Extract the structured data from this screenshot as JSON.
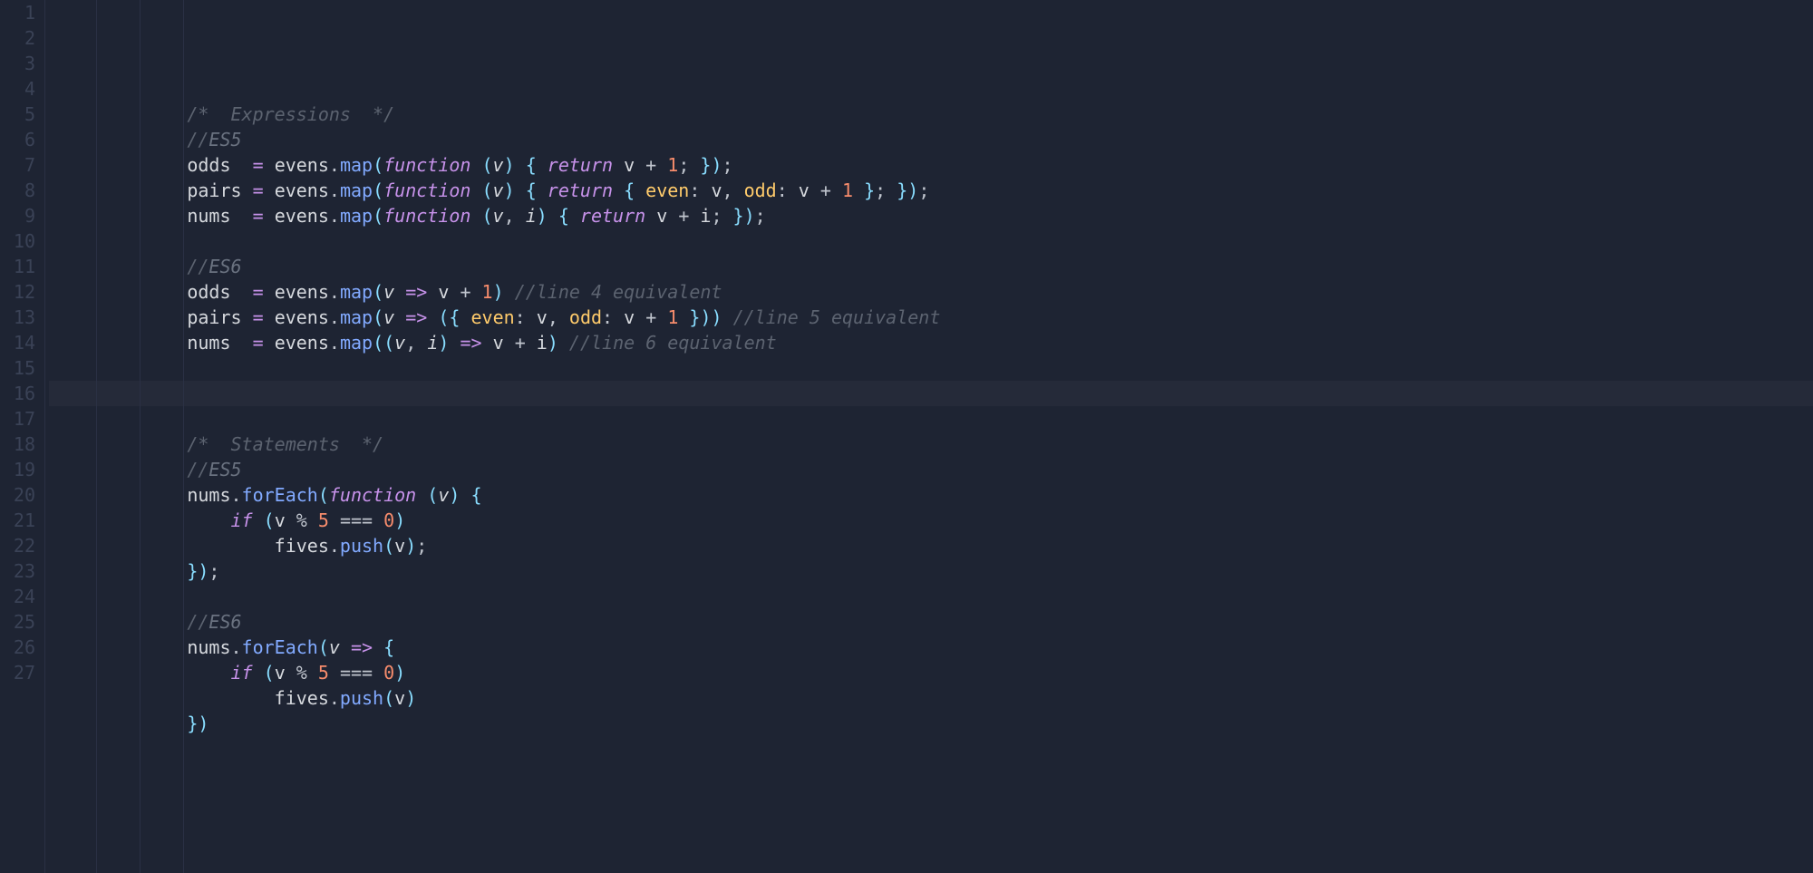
{
  "editor": {
    "line_count": 27,
    "active_line": 13,
    "lines": [
      "",
      "        /*  Expressions  */",
      "        //ES5",
      "        odds  = evens.map(function (v) { return v + 1; });",
      "        pairs = evens.map(function (v) { return { even: v, odd: v + 1 }; });",
      "        nums  = evens.map(function (v, i) { return v + i; });",
      "",
      "        //ES6",
      "        odds  = evens.map(v => v + 1) //line 4 equivalent",
      "        pairs = evens.map(v => ({ even: v, odd: v + 1 })) //line 5 equivalent",
      "        nums  = evens.map((v, i) => v + i) //line 6 equivalent",
      "",
      "",
      "",
      "        /*  Statements  */",
      "        //ES5",
      "        nums.forEach(function (v) {",
      "            if (v % 5 === 0)",
      "                fives.push(v);",
      "        });",
      "",
      "        //ES6",
      "        nums.forEach(v => {",
      "            if (v % 5 === 0)",
      "                fives.push(v)",
      "        })",
      ""
    ],
    "tokens": [
      [],
      [
        [
          "c-comment",
          "/*"
        ],
        [
          "c-comment",
          "  Expressions  "
        ],
        [
          "c-comment",
          "*/"
        ]
      ],
      [
        [
          "c-comment",
          "//"
        ],
        [
          "c-comment-light",
          "ES5"
        ]
      ],
      [
        [
          "c-var",
          "odds"
        ],
        [
          "",
          "  "
        ],
        [
          "c-assign",
          "="
        ],
        [
          "",
          " "
        ],
        [
          "c-ident",
          "evens"
        ],
        [
          "c-punct",
          "."
        ],
        [
          "c-method",
          "map"
        ],
        [
          "c-paren",
          "("
        ],
        [
          "c-keyword",
          "function"
        ],
        [
          "",
          " "
        ],
        [
          "c-paren",
          "("
        ],
        [
          "c-param",
          "v"
        ],
        [
          "c-paren",
          ")"
        ],
        [
          "",
          " "
        ],
        [
          "c-brace",
          "{"
        ],
        [
          "",
          " "
        ],
        [
          "c-keyword",
          "return"
        ],
        [
          "",
          " "
        ],
        [
          "c-ident",
          "v"
        ],
        [
          "",
          " "
        ],
        [
          "c-op",
          "+"
        ],
        [
          "",
          " "
        ],
        [
          "c-num",
          "1"
        ],
        [
          "c-punct",
          ";"
        ],
        [
          "",
          " "
        ],
        [
          "c-brace",
          "}"
        ],
        [
          "c-paren",
          ")"
        ],
        [
          "c-punct",
          ";"
        ]
      ],
      [
        [
          "c-var",
          "pairs"
        ],
        [
          "",
          " "
        ],
        [
          "c-assign",
          "="
        ],
        [
          "",
          " "
        ],
        [
          "c-ident",
          "evens"
        ],
        [
          "c-punct",
          "."
        ],
        [
          "c-method",
          "map"
        ],
        [
          "c-paren",
          "("
        ],
        [
          "c-keyword",
          "function"
        ],
        [
          "",
          " "
        ],
        [
          "c-paren",
          "("
        ],
        [
          "c-param",
          "v"
        ],
        [
          "c-paren",
          ")"
        ],
        [
          "",
          " "
        ],
        [
          "c-brace",
          "{"
        ],
        [
          "",
          " "
        ],
        [
          "c-keyword",
          "return"
        ],
        [
          "",
          " "
        ],
        [
          "c-brace",
          "{"
        ],
        [
          "",
          " "
        ],
        [
          "c-prop",
          "even"
        ],
        [
          "c-punct",
          ":"
        ],
        [
          "",
          " "
        ],
        [
          "c-ident",
          "v"
        ],
        [
          "c-punct",
          ","
        ],
        [
          "",
          " "
        ],
        [
          "c-prop",
          "odd"
        ],
        [
          "c-punct",
          ":"
        ],
        [
          "",
          " "
        ],
        [
          "c-ident",
          "v"
        ],
        [
          "",
          " "
        ],
        [
          "c-op",
          "+"
        ],
        [
          "",
          " "
        ],
        [
          "c-num",
          "1"
        ],
        [
          "",
          " "
        ],
        [
          "c-brace",
          "}"
        ],
        [
          "c-punct",
          ";"
        ],
        [
          "",
          " "
        ],
        [
          "c-brace",
          "}"
        ],
        [
          "c-paren",
          ")"
        ],
        [
          "c-punct",
          ";"
        ]
      ],
      [
        [
          "c-var",
          "nums"
        ],
        [
          "",
          "  "
        ],
        [
          "c-assign",
          "="
        ],
        [
          "",
          " "
        ],
        [
          "c-ident",
          "evens"
        ],
        [
          "c-punct",
          "."
        ],
        [
          "c-method",
          "map"
        ],
        [
          "c-paren",
          "("
        ],
        [
          "c-keyword",
          "function"
        ],
        [
          "",
          " "
        ],
        [
          "c-paren",
          "("
        ],
        [
          "c-param",
          "v"
        ],
        [
          "c-punct",
          ","
        ],
        [
          "",
          " "
        ],
        [
          "c-param",
          "i"
        ],
        [
          "c-paren",
          ")"
        ],
        [
          "",
          " "
        ],
        [
          "c-brace",
          "{"
        ],
        [
          "",
          " "
        ],
        [
          "c-keyword",
          "return"
        ],
        [
          "",
          " "
        ],
        [
          "c-ident",
          "v"
        ],
        [
          "",
          " "
        ],
        [
          "c-op",
          "+"
        ],
        [
          "",
          " "
        ],
        [
          "c-ident",
          "i"
        ],
        [
          "c-punct",
          ";"
        ],
        [
          "",
          " "
        ],
        [
          "c-brace",
          "}"
        ],
        [
          "c-paren",
          ")"
        ],
        [
          "c-punct",
          ";"
        ]
      ],
      [],
      [
        [
          "c-comment",
          "//"
        ],
        [
          "c-comment-light",
          "ES6"
        ]
      ],
      [
        [
          "c-var",
          "odds"
        ],
        [
          "",
          "  "
        ],
        [
          "c-assign",
          "="
        ],
        [
          "",
          " "
        ],
        [
          "c-ident",
          "evens"
        ],
        [
          "c-punct",
          "."
        ],
        [
          "c-method",
          "map"
        ],
        [
          "c-paren",
          "("
        ],
        [
          "c-param",
          "v"
        ],
        [
          "",
          " "
        ],
        [
          "c-arrow",
          "=>"
        ],
        [
          "",
          " "
        ],
        [
          "c-ident",
          "v"
        ],
        [
          "",
          " "
        ],
        [
          "c-op",
          "+"
        ],
        [
          "",
          " "
        ],
        [
          "c-num",
          "1"
        ],
        [
          "c-paren",
          ")"
        ],
        [
          "",
          " "
        ],
        [
          "c-comment",
          "//line 4 equivalent"
        ]
      ],
      [
        [
          "c-var",
          "pairs"
        ],
        [
          "",
          " "
        ],
        [
          "c-assign",
          "="
        ],
        [
          "",
          " "
        ],
        [
          "c-ident",
          "evens"
        ],
        [
          "c-punct",
          "."
        ],
        [
          "c-method",
          "map"
        ],
        [
          "c-paren",
          "("
        ],
        [
          "c-param",
          "v"
        ],
        [
          "",
          " "
        ],
        [
          "c-arrow",
          "=>"
        ],
        [
          "",
          " "
        ],
        [
          "c-paren",
          "("
        ],
        [
          "c-brace",
          "{"
        ],
        [
          "",
          " "
        ],
        [
          "c-prop",
          "even"
        ],
        [
          "c-punct",
          ":"
        ],
        [
          "",
          " "
        ],
        [
          "c-ident",
          "v"
        ],
        [
          "c-punct",
          ","
        ],
        [
          "",
          " "
        ],
        [
          "c-prop",
          "odd"
        ],
        [
          "c-punct",
          ":"
        ],
        [
          "",
          " "
        ],
        [
          "c-ident",
          "v"
        ],
        [
          "",
          " "
        ],
        [
          "c-op",
          "+"
        ],
        [
          "",
          " "
        ],
        [
          "c-num",
          "1"
        ],
        [
          "",
          " "
        ],
        [
          "c-brace",
          "}"
        ],
        [
          "c-paren",
          ")"
        ],
        [
          "c-paren",
          ")"
        ],
        [
          "",
          " "
        ],
        [
          "c-comment",
          "//line 5 equivalent"
        ]
      ],
      [
        [
          "c-var",
          "nums"
        ],
        [
          "",
          "  "
        ],
        [
          "c-assign",
          "="
        ],
        [
          "",
          " "
        ],
        [
          "c-ident",
          "evens"
        ],
        [
          "c-punct",
          "."
        ],
        [
          "c-method",
          "map"
        ],
        [
          "c-paren",
          "("
        ],
        [
          "c-paren",
          "("
        ],
        [
          "c-param",
          "v"
        ],
        [
          "c-punct",
          ","
        ],
        [
          "",
          " "
        ],
        [
          "c-param",
          "i"
        ],
        [
          "c-paren",
          ")"
        ],
        [
          "",
          " "
        ],
        [
          "c-arrow",
          "=>"
        ],
        [
          "",
          " "
        ],
        [
          "c-ident",
          "v"
        ],
        [
          "",
          " "
        ],
        [
          "c-op",
          "+"
        ],
        [
          "",
          " "
        ],
        [
          "c-ident",
          "i"
        ],
        [
          "c-paren",
          ")"
        ],
        [
          "",
          " "
        ],
        [
          "c-comment",
          "//line 6 equivalent"
        ]
      ],
      [],
      [],
      [],
      [
        [
          "c-comment",
          "/*"
        ],
        [
          "c-comment",
          "  Statements  "
        ],
        [
          "c-comment",
          "*/"
        ]
      ],
      [
        [
          "c-comment",
          "//"
        ],
        [
          "c-comment-light",
          "ES5"
        ]
      ],
      [
        [
          "c-ident",
          "nums"
        ],
        [
          "c-punct",
          "."
        ],
        [
          "c-method",
          "forEach"
        ],
        [
          "c-paren",
          "("
        ],
        [
          "c-keyword",
          "function"
        ],
        [
          "",
          " "
        ],
        [
          "c-paren",
          "("
        ],
        [
          "c-param",
          "v"
        ],
        [
          "c-paren",
          ")"
        ],
        [
          "",
          " "
        ],
        [
          "c-brace",
          "{"
        ]
      ],
      [
        [
          "",
          "    "
        ],
        [
          "c-keyword",
          "if"
        ],
        [
          "",
          " "
        ],
        [
          "c-paren",
          "("
        ],
        [
          "c-ident",
          "v"
        ],
        [
          "",
          " "
        ],
        [
          "c-op",
          "%"
        ],
        [
          "",
          " "
        ],
        [
          "c-num",
          "5"
        ],
        [
          "",
          " "
        ],
        [
          "c-op",
          "==="
        ],
        [
          "",
          " "
        ],
        [
          "c-num",
          "0"
        ],
        [
          "c-paren",
          ")"
        ]
      ],
      [
        [
          "",
          "        "
        ],
        [
          "c-ident",
          "fives"
        ],
        [
          "c-punct",
          "."
        ],
        [
          "c-method",
          "push"
        ],
        [
          "c-paren",
          "("
        ],
        [
          "c-ident",
          "v"
        ],
        [
          "c-paren",
          ")"
        ],
        [
          "c-punct",
          ";"
        ]
      ],
      [
        [
          "c-brace",
          "}"
        ],
        [
          "c-paren",
          ")"
        ],
        [
          "c-punct",
          ";"
        ]
      ],
      [],
      [
        [
          "c-comment",
          "//"
        ],
        [
          "c-comment-light",
          "ES6"
        ]
      ],
      [
        [
          "c-ident",
          "nums"
        ],
        [
          "c-punct",
          "."
        ],
        [
          "c-method",
          "forEach"
        ],
        [
          "c-paren",
          "("
        ],
        [
          "c-param",
          "v"
        ],
        [
          "",
          " "
        ],
        [
          "c-arrow",
          "=>"
        ],
        [
          "",
          " "
        ],
        [
          "c-brace",
          "{"
        ]
      ],
      [
        [
          "",
          "    "
        ],
        [
          "c-keyword",
          "if"
        ],
        [
          "",
          " "
        ],
        [
          "c-paren",
          "("
        ],
        [
          "c-ident",
          "v"
        ],
        [
          "",
          " "
        ],
        [
          "c-op",
          "%"
        ],
        [
          "",
          " "
        ],
        [
          "c-num",
          "5"
        ],
        [
          "",
          " "
        ],
        [
          "c-op",
          "==="
        ],
        [
          "",
          " "
        ],
        [
          "c-num",
          "0"
        ],
        [
          "c-paren",
          ")"
        ]
      ],
      [
        [
          "",
          "        "
        ],
        [
          "c-ident",
          "fives"
        ],
        [
          "c-punct",
          "."
        ],
        [
          "c-method",
          "push"
        ],
        [
          "c-paren",
          "("
        ],
        [
          "c-ident",
          "v"
        ],
        [
          "c-paren",
          ")"
        ]
      ],
      [
        [
          "c-brace",
          "}"
        ],
        [
          "c-paren",
          ")"
        ]
      ],
      []
    ],
    "base_indent": "        "
  }
}
